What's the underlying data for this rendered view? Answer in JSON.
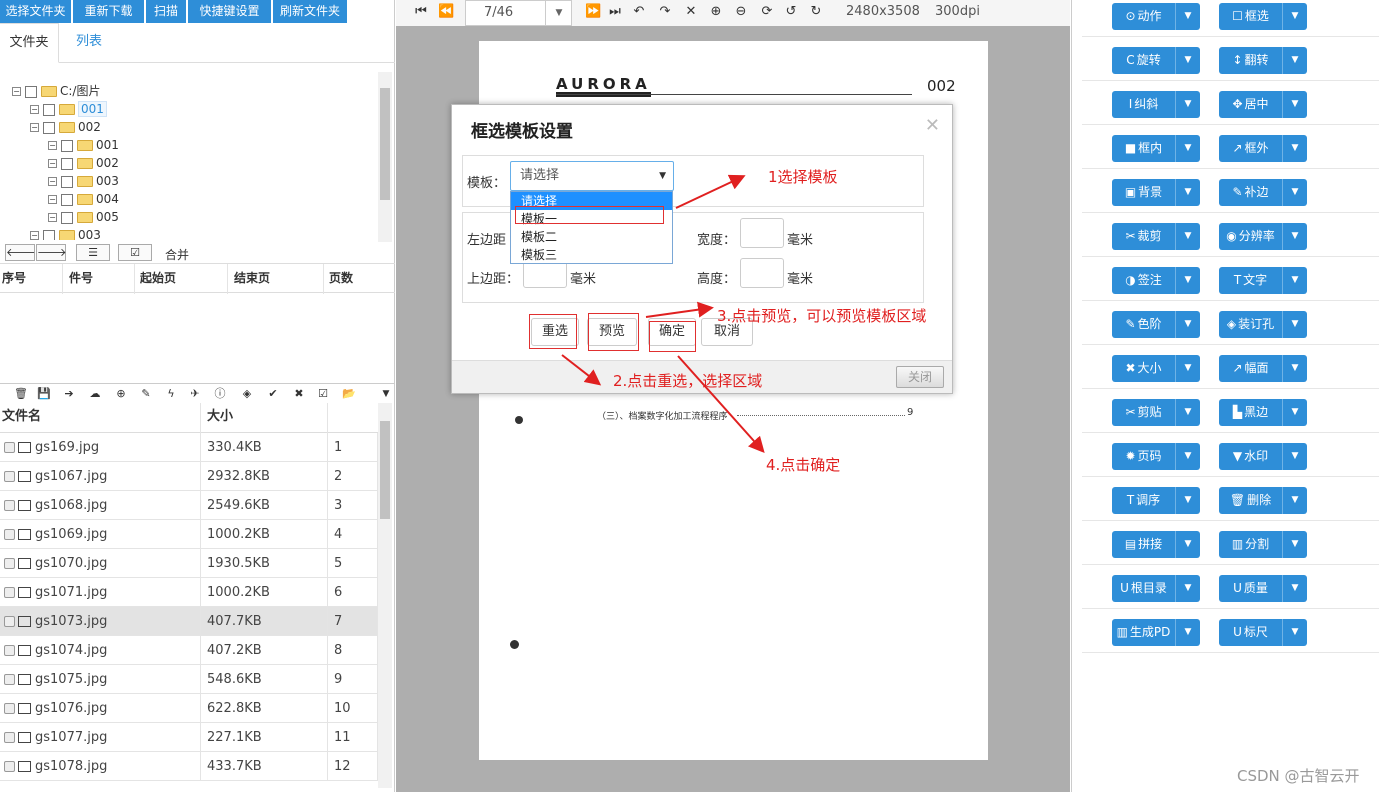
{
  "top_buttons": [
    "选择文件夹",
    "重新下载",
    "扫描",
    "快捷键设置",
    "刷新文件夹"
  ],
  "tabs": [
    "文件夹",
    "列表"
  ],
  "tree": {
    "root": "C:/图片",
    "nodes": [
      "001",
      "002",
      "001",
      "002",
      "003",
      "004",
      "005",
      "003"
    ]
  },
  "nav": {
    "merge_label": "合并"
  },
  "segment_table": {
    "headers": [
      "序号",
      "件号",
      "起始页",
      "结束页",
      "页数"
    ]
  },
  "file_table": {
    "headers": [
      "文件名",
      "大小"
    ],
    "rows": [
      {
        "name": "gs169.jpg",
        "size": "330.4KB",
        "idx": "1"
      },
      {
        "name": "gs1067.jpg",
        "size": "2932.8KB",
        "idx": "2"
      },
      {
        "name": "gs1068.jpg",
        "size": "2549.6KB",
        "idx": "3"
      },
      {
        "name": "gs1069.jpg",
        "size": "1000.2KB",
        "idx": "4"
      },
      {
        "name": "gs1070.jpg",
        "size": "1930.5KB",
        "idx": "5"
      },
      {
        "name": "gs1071.jpg",
        "size": "1000.2KB",
        "idx": "6"
      },
      {
        "name": "gs1073.jpg",
        "size": "407.7KB",
        "idx": "7"
      },
      {
        "name": "gs1074.jpg",
        "size": "407.2KB",
        "idx": "8"
      },
      {
        "name": "gs1075.jpg",
        "size": "548.6KB",
        "idx": "9"
      },
      {
        "name": "gs1076.jpg",
        "size": "622.8KB",
        "idx": "10"
      },
      {
        "name": "gs1077.jpg",
        "size": "227.1KB",
        "idx": "11"
      },
      {
        "name": "gs1078.jpg",
        "size": "433.7KB",
        "idx": "12"
      }
    ]
  },
  "viewer": {
    "page_indicator": "7/46",
    "dimensions": "2480x3508",
    "dpi": "300dpi",
    "doc_logo": "AURORA",
    "doc_page_no": "002",
    "doc_line": "（三）、档案数字化加工流程程序",
    "doc_line_page": "9"
  },
  "modal": {
    "title": "框选模板设置",
    "template_label": "模板：",
    "select_value": "请选择",
    "options": [
      "请选择",
      "模板一",
      "模板二",
      "模板三"
    ],
    "left_margin_label": "左边距",
    "top_margin_label": "上边距：",
    "width_label": "宽度：",
    "height_label": "高度：",
    "unit": "毫米",
    "btn_reselect": "重选",
    "btn_preview": "预览",
    "btn_confirm": "确定",
    "btn_cancel": "取消",
    "btn_close": "关闭"
  },
  "annotations": {
    "a1": "1选择模板",
    "a2": "2.点击重选，选择区域",
    "a3": "3.点击预览，可以预览模板区域",
    "a4": "4.点击确定"
  },
  "right_buttons": [
    [
      "动作",
      "框选"
    ],
    [
      "旋转",
      "翻转"
    ],
    [
      "纠斜",
      "居中"
    ],
    [
      "框内",
      "框外"
    ],
    [
      "背景",
      "补边"
    ],
    [
      "裁剪",
      "分辨率"
    ],
    [
      "签注",
      "文字"
    ],
    [
      "色阶",
      "装订孔"
    ],
    [
      "大小",
      "幅面"
    ],
    [
      "剪贴",
      "黑边"
    ],
    [
      "页码",
      "水印"
    ],
    [
      "调序",
      "删除"
    ],
    [
      "拼接",
      "分割"
    ],
    [
      "根目录",
      "质量"
    ],
    [
      "生成PD",
      "标尺"
    ]
  ],
  "right_icons": [
    [
      "⊙",
      "☐"
    ],
    [
      "C",
      "↕"
    ],
    [
      "I",
      "✥"
    ],
    [
      "■",
      "↗"
    ],
    [
      "▣",
      "✎"
    ],
    [
      "✂",
      "◉"
    ],
    [
      "◑",
      "T"
    ],
    [
      "✎",
      "◈"
    ],
    [
      "✖",
      "↗"
    ],
    [
      "✂",
      "▙"
    ],
    [
      "✹",
      "▼"
    ],
    [
      "T",
      "🗑"
    ],
    [
      "▤",
      "▥"
    ],
    [
      "U",
      "U"
    ],
    [
      "▥",
      "U"
    ]
  ],
  "watermark": "CSDN @古智云开",
  "colors": {
    "accent": "#2e8ed8",
    "annotation": "#e02020"
  }
}
